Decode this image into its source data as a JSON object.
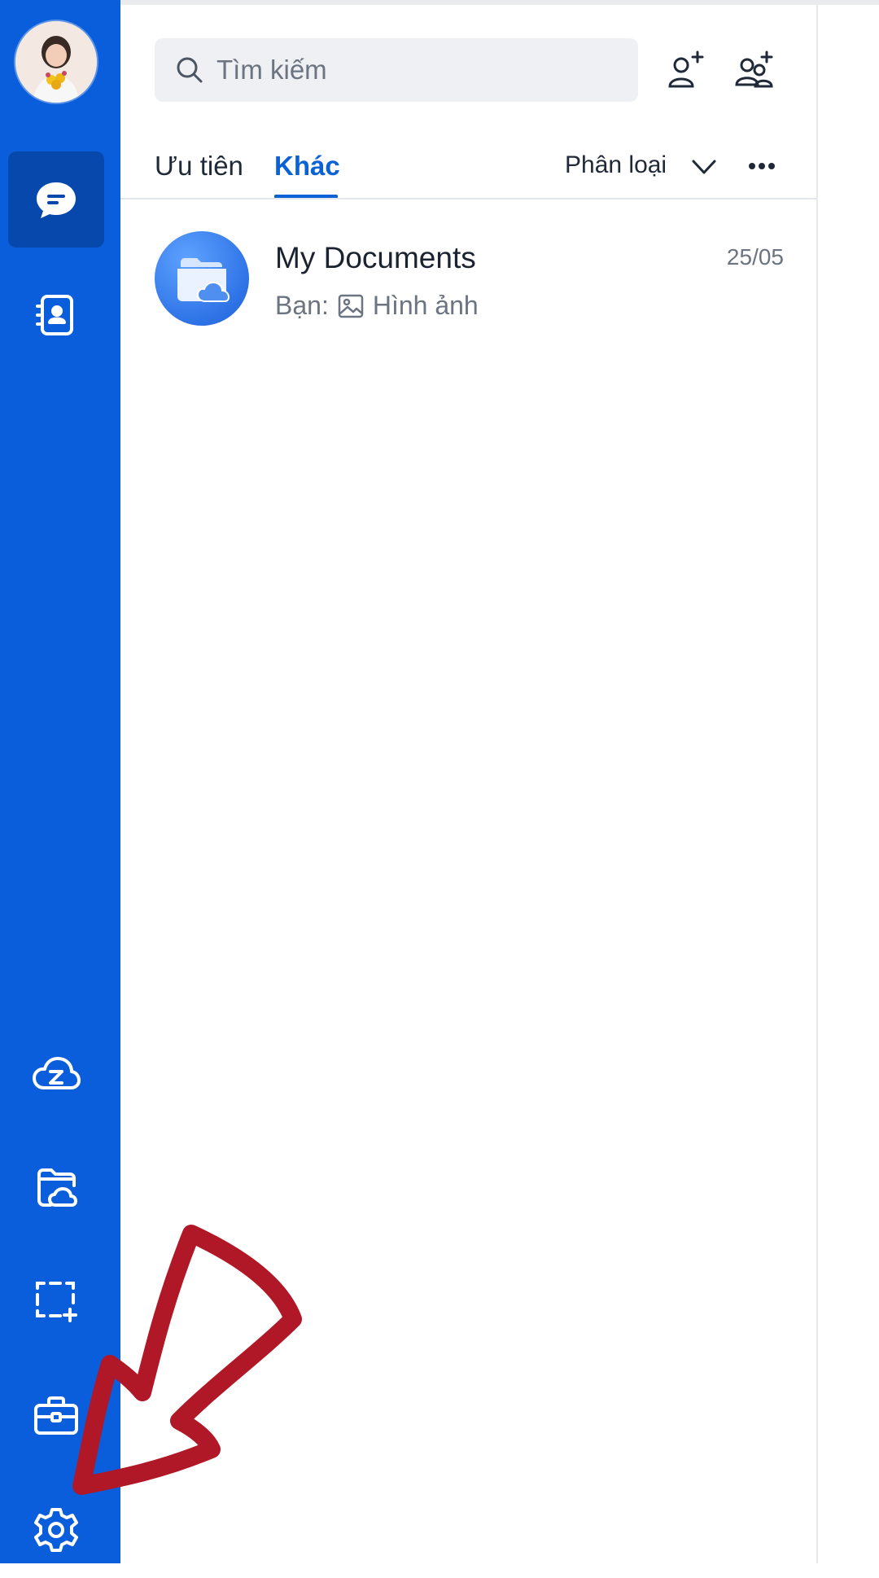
{
  "colors": {
    "sidebar": "#0a5ddb",
    "sidebar_active": "#0748ad",
    "accent": "#0a62d6",
    "annotation": "#b01828"
  },
  "sidebar": {
    "items": [
      {
        "name": "messages",
        "icon": "chat-bubble-icon",
        "active": true
      },
      {
        "name": "contacts",
        "icon": "contact-book-icon"
      },
      {
        "name": "cloud",
        "icon": "zalo-cloud-icon"
      },
      {
        "name": "my-documents",
        "icon": "cloud-folder-icon"
      },
      {
        "name": "screenshot",
        "icon": "screen-capture-icon"
      },
      {
        "name": "toolbox",
        "icon": "briefcase-icon"
      },
      {
        "name": "settings",
        "icon": "gear-icon"
      }
    ]
  },
  "search": {
    "placeholder": "Tìm kiếm"
  },
  "tabs": [
    {
      "label": "Ưu tiên",
      "active": false
    },
    {
      "label": "Khác",
      "active": true
    }
  ],
  "filter": {
    "label": "Phân loại"
  },
  "conversations": [
    {
      "title": "My Documents",
      "date": "25/05",
      "preview_prefix": "Bạn:",
      "preview_text": "Hình ảnh"
    }
  ]
}
